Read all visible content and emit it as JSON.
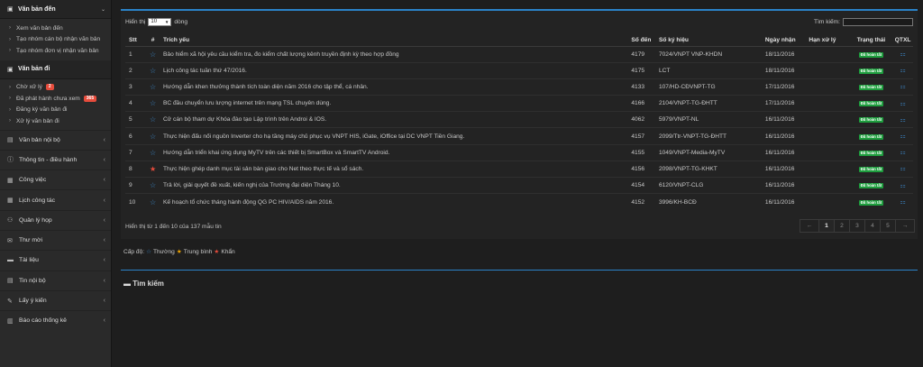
{
  "sidebar": {
    "header1": {
      "label": "Văn bản đến"
    },
    "group1": [
      {
        "label": "Xem văn bản đến"
      },
      {
        "label": "Tạo nhóm cán bộ nhận văn bản"
      },
      {
        "label": "Tạo nhóm đơn vị nhận văn bản"
      }
    ],
    "header2": {
      "label": "Văn bản đi"
    },
    "group2": [
      {
        "label": "Chờ xử lý",
        "badge": "2"
      },
      {
        "label": "Đã phát hành chưa xem",
        "badge": "365"
      },
      {
        "label": "Đăng ký văn bản đi",
        "badge": ""
      },
      {
        "label": "Xử lý văn bản đi",
        "badge": ""
      }
    ],
    "items": [
      {
        "label": "Văn bản nội bộ",
        "icon": "file-icon"
      },
      {
        "label": "Thông tin - điều hành",
        "icon": "info-icon"
      },
      {
        "label": "Công việc",
        "icon": "briefcase-icon"
      },
      {
        "label": "Lịch công tác",
        "icon": "calendar-icon"
      },
      {
        "label": "Quản lý họp",
        "icon": "people-icon"
      },
      {
        "label": "Thư mời",
        "icon": "envelope-icon"
      },
      {
        "label": "Tài liệu",
        "icon": "folder-icon"
      },
      {
        "label": "Tin nội bộ",
        "icon": "news-icon"
      },
      {
        "label": "Lấy ý kiến",
        "icon": "comment-icon"
      },
      {
        "label": "Báo cáo thống kê",
        "icon": "bar-chart-icon"
      }
    ]
  },
  "controls": {
    "show_label": "Hiển thị",
    "page_size": "10",
    "rows_label": "dòng",
    "search_label": "Tìm kiếm:"
  },
  "table": {
    "headers": {
      "stt": "Stt",
      "hash": "#",
      "trich_yeu": "Trích yếu",
      "so_den": "Số đến",
      "so_ky_hieu": "Số ký hiệu",
      "ngay_nhan": "Ngày nhận",
      "han_xu_ly": "Hạn xử lý",
      "trang_thai": "Trạng thái",
      "qtxl": "QTXL"
    },
    "rows": [
      {
        "stt": "1",
        "priority": "normal",
        "trich_yeu": "Bảo hiểm xã hội yêu cầu kiểm tra, đo kiểm chất lượng kênh truyền định kỳ theo hợp đồng",
        "so_den": "4179",
        "so_ky_hieu": "7024/VNPT VNP-KHDN",
        "ngay_nhan": "18/11/2016",
        "han_xu_ly": "",
        "trang_thai": "Đã hoàn tất"
      },
      {
        "stt": "2",
        "priority": "normal",
        "trich_yeu": "Lịch công tác tuần thứ 47/2016.",
        "so_den": "4175",
        "so_ky_hieu": "LCT",
        "ngay_nhan": "18/11/2016",
        "han_xu_ly": "",
        "trang_thai": "Đã hoàn tất"
      },
      {
        "stt": "3",
        "priority": "normal",
        "trich_yeu": "Hướng dẫn khen thưởng thành tích toàn diện năm 2016 cho tập thể, cá nhân.",
        "so_den": "4133",
        "so_ky_hieu": "107/HD-CĐVNPT-TG",
        "ngay_nhan": "17/11/2016",
        "han_xu_ly": "",
        "trang_thai": "Đã hoàn tất"
      },
      {
        "stt": "4",
        "priority": "normal",
        "trich_yeu": "BC đầu chuyển lưu lượng internet trên mạng TSL chuyên dùng.",
        "so_den": "4166",
        "so_ky_hieu": "2104/VNPT-TG-ĐHTT",
        "ngay_nhan": "17/11/2016",
        "han_xu_ly": "",
        "trang_thai": "Đã hoàn tất"
      },
      {
        "stt": "5",
        "priority": "normal",
        "trich_yeu": "Cử cán bộ tham dự Khóa đào tạo Lập trình trên Androi & IOS.",
        "so_den": "4062",
        "so_ky_hieu": "5979/VNPT-NL",
        "ngay_nhan": "16/11/2016",
        "han_xu_ly": "",
        "trang_thai": "Đã hoàn tất"
      },
      {
        "stt": "6",
        "priority": "normal",
        "trich_yeu": "Thực hiện đấu nối nguồn Inverter cho hạ tầng máy chủ phục vụ VNPT HIS, iGate, iOffice tại DC VNPT Tiền Giang.",
        "so_den": "4157",
        "so_ky_hieu": "2099/Ttr-VNPT-TG-ĐHTT",
        "ngay_nhan": "16/11/2016",
        "han_xu_ly": "",
        "trang_thai": "Đã hoàn tất"
      },
      {
        "stt": "7",
        "priority": "normal",
        "trich_yeu": "Hướng dẫn triển khai ứng dụng MyTV trên các thiết bị SmartBox và SmartTV Android.",
        "so_den": "4155",
        "so_ky_hieu": "1049/VNPT-Media-MyTV",
        "ngay_nhan": "16/11/2016",
        "han_xu_ly": "",
        "trang_thai": "Đã hoàn tất"
      },
      {
        "stt": "8",
        "priority": "urgent",
        "trich_yeu": "Thực hiện ghép danh mục tài sản bàn giao cho Net theo thực tế và sổ sách.",
        "so_den": "4156",
        "so_ky_hieu": "2098/VNPT-TG-KHKT",
        "ngay_nhan": "16/11/2016",
        "han_xu_ly": "",
        "trang_thai": "Đã hoàn tất"
      },
      {
        "stt": "9",
        "priority": "normal",
        "trich_yeu": "Trả lời, giải quyết đề xuất, kiến nghị của Trường đại diện Tháng 10.",
        "so_den": "4154",
        "so_ky_hieu": "6120/VNPT-CLG",
        "ngay_nhan": "16/11/2016",
        "han_xu_ly": "",
        "trang_thai": "Đã hoàn tất"
      },
      {
        "stt": "10",
        "priority": "normal",
        "trich_yeu": "Kế hoạch tổ chức tháng hành động QG PC HIV/AIDS năm 2016.",
        "so_den": "4152",
        "so_ky_hieu": "3996/KH-BCĐ",
        "ngay_nhan": "16/11/2016",
        "han_xu_ly": "",
        "trang_thai": "Đã hoàn tất"
      }
    ]
  },
  "info_text": "Hiển thị từ 1 đến 10 của 137 mẫu tin",
  "pagination": {
    "prev": "←",
    "pages": [
      "1",
      "2",
      "3",
      "4",
      "5"
    ],
    "active": "1",
    "next": "→"
  },
  "legend": {
    "label": "Cấp độ:",
    "normal": "Thường",
    "medium": "Trung bình",
    "urgent": "Khẩn"
  },
  "search_section": {
    "title": "Tìm kiếm"
  },
  "colors": {
    "accent": "#2b83c9",
    "status_done": "#1e9e3e",
    "badge": "#e74c3c",
    "star_normal": "#3b86c7",
    "star_medium": "#f0a500",
    "star_urgent": "#e74c3c"
  }
}
